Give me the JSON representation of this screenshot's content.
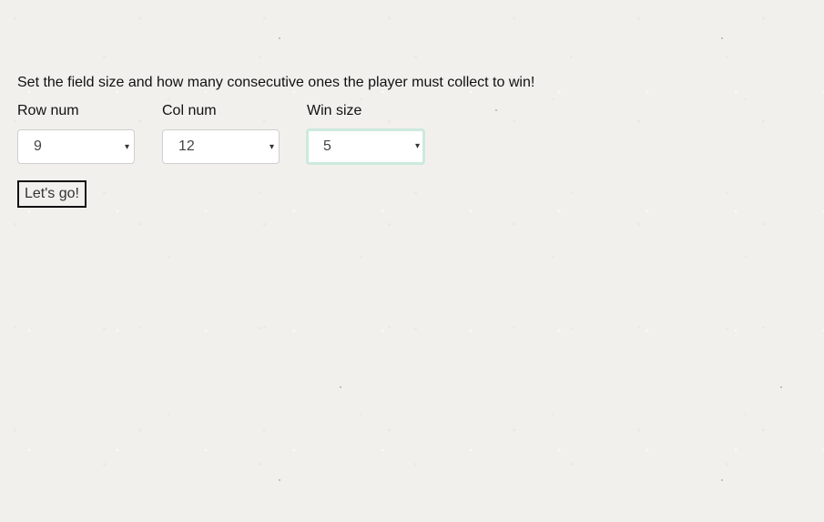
{
  "intro": {
    "text": "Set the field size and how many consecutive ones the player must collect to win!"
  },
  "fields": {
    "row": {
      "label": "Row num",
      "value": "9"
    },
    "col": {
      "label": "Col num",
      "value": "12"
    },
    "win": {
      "label": "Win size",
      "value": "5"
    }
  },
  "start_button": {
    "label": "Let's go!"
  },
  "icons": {
    "dropdown": "chevron-down-icon"
  },
  "colors": {
    "background": "#f2f0ed",
    "focus_border": "#cde9de",
    "select_border": "#cfcfcf"
  }
}
